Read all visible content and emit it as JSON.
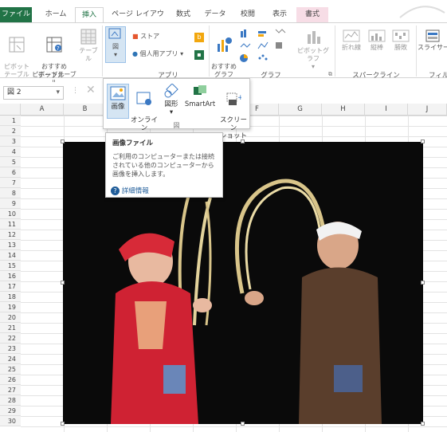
{
  "tabs": {
    "file": "ファイル",
    "home": "ホーム",
    "insert": "挿入",
    "page_layout": "ページ レイアウト",
    "formulas": "数式",
    "data": "データ",
    "review": "校閲",
    "view": "表示",
    "format": "書式"
  },
  "ribbon": {
    "pivot_table": "ピボット\nテーブル",
    "recommended_pivot": "おすすめ\nピボットテーブル",
    "table": "テーブル",
    "tables_group": "テーブル",
    "illustrations": "図",
    "store": "ストア",
    "my_apps": "個人用アプリ",
    "apps_group": "アプリ",
    "recommended_charts": "おすすめ\nグラフ",
    "pivot_chart": "ピボットグラフ",
    "charts_group": "グラフ",
    "line": "折れ線",
    "column": "縦棒",
    "win_loss": "勝敗",
    "sparklines_group": "スパークライン",
    "slicer": "スライサー",
    "filter_group": "フィル"
  },
  "formula_bar": {
    "name_box": "図 2"
  },
  "dropdown": {
    "picture": "画像",
    "online_pictures": "オンライン\n画像",
    "shapes": "図形",
    "smartart": "SmartArt",
    "screenshot": "スクリーン\nショット",
    "group_label": "図"
  },
  "tooltip": {
    "title": "画像ファイル",
    "body": "ご利用のコンピューターまたは接続されている他のコンピューターから画像を挿入します。",
    "link": "詳細情報"
  },
  "columns": [
    "A",
    "B",
    "C",
    "D",
    "E",
    "F",
    "G",
    "H",
    "I",
    "J"
  ],
  "rows": [
    "1",
    "2",
    "3",
    "4",
    "5",
    "6",
    "7",
    "8",
    "9",
    "10",
    "11",
    "12",
    "13",
    "14",
    "15",
    "16",
    "17",
    "18",
    "19",
    "20",
    "21",
    "22",
    "23",
    "24",
    "25",
    "26",
    "27",
    "28",
    "29",
    "30"
  ],
  "colors": {
    "accent": "#217346",
    "format_tab": "#f7dde6",
    "photo_bg": "#0a0a0a"
  }
}
